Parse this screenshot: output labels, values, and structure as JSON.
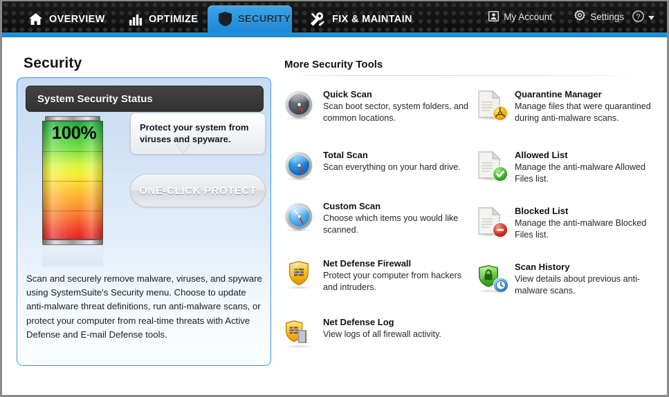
{
  "window": {
    "accent_blue": "#2a93dd",
    "nav_background": "#121212"
  },
  "nav": {
    "tabs": [
      {
        "label": "OVERVIEW",
        "icon": "home-icon",
        "active": false
      },
      {
        "label": "OPTIMIZE",
        "icon": "bar-chart-icon",
        "active": false
      },
      {
        "label": "SECURITY",
        "icon": "shield-icon",
        "active": true
      },
      {
        "label": "FIX & MAINTAIN",
        "icon": "tools-icon",
        "active": false
      }
    ],
    "account_label": "My Account",
    "account_icon": "user-card-icon",
    "settings_label": "Settings",
    "settings_icon": "gear-icon",
    "help_icon": "help-circle-icon",
    "help_caret_icon": "chevron-down-icon"
  },
  "page": {
    "title": "Security"
  },
  "status_panel": {
    "header": "System Security Status",
    "gauge_percent": "100%",
    "gauge_value": 100,
    "bubble_text": "Protect your system from viruses and spyware.",
    "protect_button": "ONE-CLICK PROTECT",
    "description": "Scan and securely remove malware, viruses, and spyware using SystemSuite's Security menu. Choose to update anti-malware threat definitions, run anti-malware scans, or protect your computer from real-time threats with Active Defense and E-mail Defense tools."
  },
  "tools": {
    "title": "More Security Tools",
    "left": [
      {
        "name": "Quick Scan",
        "desc": "Scan boot sector, system folders, and common locations.",
        "icon": "quick-scan-gauge-icon"
      },
      {
        "name": "Total Scan",
        "desc": "Scan everything on your hard drive.",
        "icon": "total-scan-gauge-icon"
      },
      {
        "name": "Custom Scan",
        "desc": "Choose which items you would like scanned.",
        "icon": "custom-scan-gauge-icon"
      },
      {
        "name": "Net Defense Firewall",
        "desc": "Protect your computer from hackers and intruders.",
        "icon": "firewall-shield-icon"
      },
      {
        "name": "Net Defense Log",
        "desc": "View logs of all firewall activity.",
        "icon": "firewall-log-icon"
      }
    ],
    "right": [
      {
        "name": "Quarantine Manager",
        "desc": "Manage files that were quarantined during anti-malware scans.",
        "icon": "quarantine-document-icon"
      },
      {
        "name": "Allowed List",
        "desc": "Manage the anti-malware Allowed Files list.",
        "icon": "allowed-document-icon"
      },
      {
        "name": "Blocked List",
        "desc": "Manage the anti-malware Blocked Files list.",
        "icon": "blocked-document-icon"
      },
      {
        "name": "Scan History",
        "desc": "View details about previous anti-malware scans.",
        "icon": "scan-history-shield-icon"
      }
    ]
  }
}
